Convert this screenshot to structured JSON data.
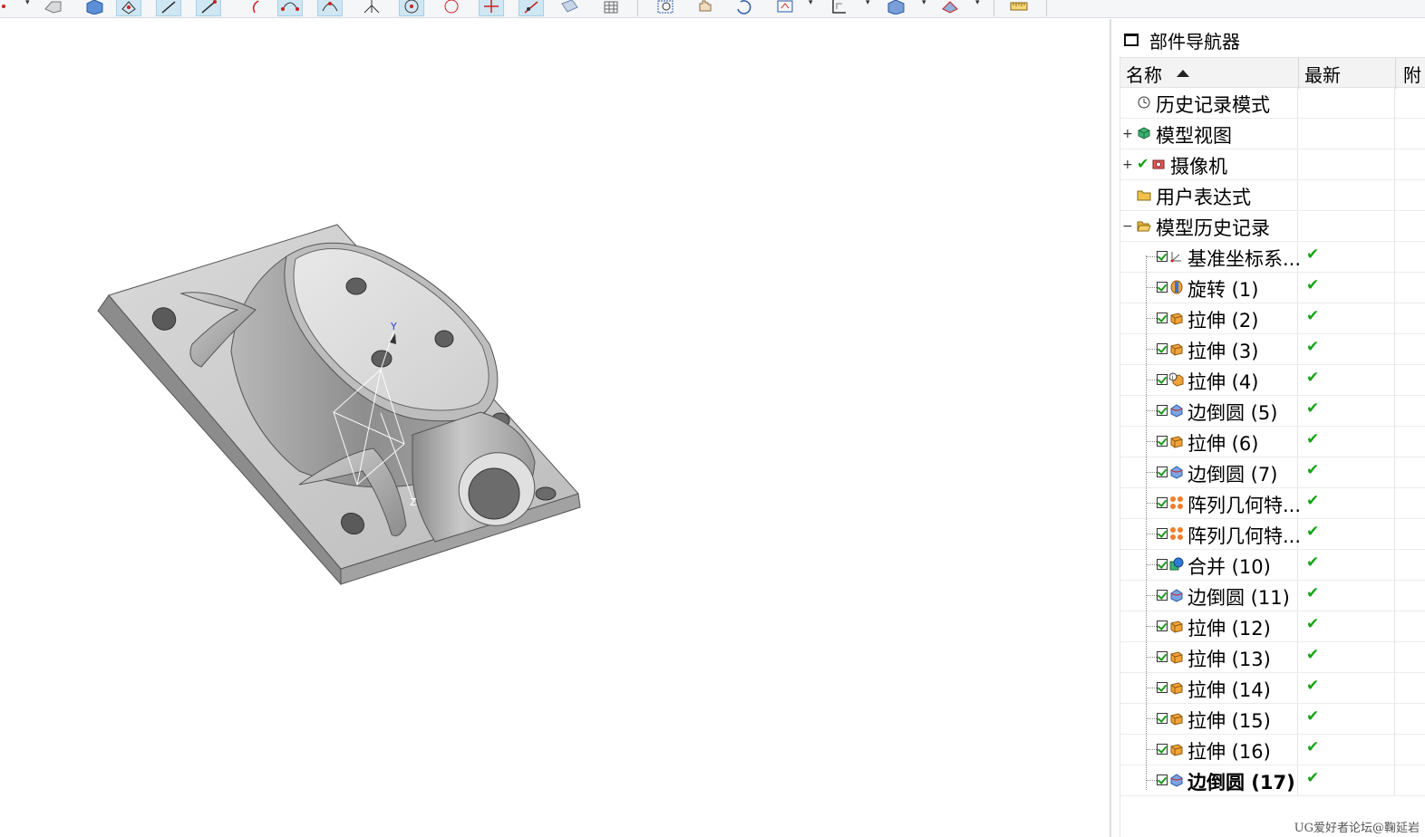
{
  "toolbar": {
    "buttons": [
      "point-icon",
      "block-icon",
      "cube-icon",
      "snap-grid-icon",
      "line-icon",
      "line-snap-icon",
      "arc-icon",
      "curve-through-icon",
      "curve-points-icon",
      "cross-icon",
      "circle-center-icon",
      "circle-icon",
      "point-on-curve-icon",
      "point-on-line-icon",
      "sheet-icon",
      "grid-icon",
      "zoom-window-icon",
      "pan-icon",
      "rotate-icon",
      "fit-icon",
      "orient-icon",
      "shaded-cube-icon",
      "render-icon",
      "ruler-icon"
    ]
  },
  "viewport": {
    "axis_labels": {
      "y": "Y",
      "z": "Z"
    }
  },
  "navigator": {
    "title": "部件导航器",
    "columns": {
      "name": "名称",
      "latest": "最新",
      "extra": "附"
    },
    "rows": [
      {
        "label": "历史记录模式",
        "icon": "clock-icon",
        "expander": ""
      },
      {
        "label": "模型视图",
        "icon": "model-view-icon",
        "expander": "+"
      },
      {
        "label": "摄像机",
        "icon": "camera-icon",
        "expander": "+"
      },
      {
        "label": "用户表达式",
        "icon": "folder-icon",
        "expander": ""
      },
      {
        "label": "模型历史记录",
        "icon": "folder-open-icon",
        "expander": "−"
      }
    ],
    "features": [
      {
        "label": "基准坐标系...",
        "icon": "datum-csys-icon",
        "latest": "✔"
      },
      {
        "label": "旋转 (1)",
        "icon": "revolve-icon",
        "latest": "✔"
      },
      {
        "label": "拉伸 (2)",
        "icon": "extrude-icon",
        "latest": "✔"
      },
      {
        "label": "拉伸 (3)",
        "icon": "extrude-icon",
        "latest": "✔"
      },
      {
        "label": "拉伸 (4)",
        "icon": "extrude-info-icon",
        "latest": "✔"
      },
      {
        "label": "边倒圆 (5)",
        "icon": "edge-blend-icon",
        "latest": "✔"
      },
      {
        "label": "拉伸 (6)",
        "icon": "extrude-icon",
        "latest": "✔"
      },
      {
        "label": "边倒圆 (7)",
        "icon": "edge-blend-icon",
        "latest": "✔"
      },
      {
        "label": "阵列几何特...",
        "icon": "pattern-icon",
        "latest": "✔"
      },
      {
        "label": "阵列几何特...",
        "icon": "pattern-icon",
        "latest": "✔"
      },
      {
        "label": "合并 (10)",
        "icon": "unite-icon",
        "latest": "✔"
      },
      {
        "label": "边倒圆 (11)",
        "icon": "edge-blend-icon",
        "latest": "✔"
      },
      {
        "label": "拉伸 (12)",
        "icon": "extrude-icon",
        "latest": "✔"
      },
      {
        "label": "拉伸 (13)",
        "icon": "extrude-icon",
        "latest": "✔"
      },
      {
        "label": "拉伸 (14)",
        "icon": "extrude-icon",
        "latest": "✔"
      },
      {
        "label": "拉伸 (15)",
        "icon": "extrude-icon",
        "latest": "✔"
      },
      {
        "label": "拉伸 (16)",
        "icon": "extrude-icon",
        "latest": "✔"
      },
      {
        "label": "边倒圆 (17)",
        "icon": "edge-blend-icon",
        "latest": "✔"
      }
    ],
    "current_feature_index": 17
  },
  "watermark": "UG爱好者论坛@鞠延岩",
  "colors": {
    "accent_check": "#17a317",
    "selected_button": "#cfe6f3",
    "model_gray": "#9a9a9a"
  }
}
